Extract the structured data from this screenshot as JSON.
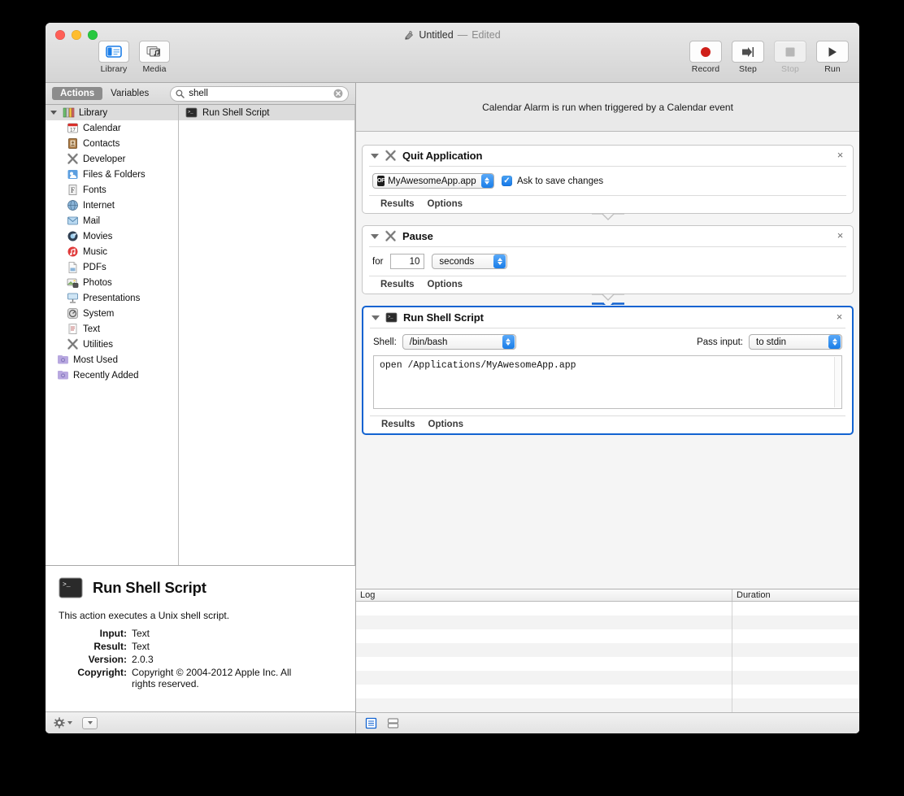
{
  "window": {
    "title": "Untitled",
    "title_separator": "—",
    "edited_status": "Edited",
    "traffic_lights": [
      "close",
      "minimize",
      "zoom"
    ]
  },
  "toolbar": {
    "left_items": [
      {
        "label": "Library",
        "icon": "library-icon",
        "active": true
      },
      {
        "label": "Media",
        "icon": "media-icon",
        "active": false
      }
    ],
    "right_items": [
      {
        "label": "Record",
        "icon": "record-icon",
        "enabled": true
      },
      {
        "label": "Step",
        "icon": "step-icon",
        "enabled": true
      },
      {
        "label": "Stop",
        "icon": "stop-icon",
        "enabled": false
      },
      {
        "label": "Run",
        "icon": "run-icon",
        "enabled": true
      }
    ]
  },
  "library": {
    "tabs": [
      {
        "label": "Actions",
        "active": true
      },
      {
        "label": "Variables",
        "active": false
      }
    ],
    "search": {
      "value": "shell",
      "placeholder": "",
      "icon": "search-icon",
      "clear_icon": "clear-icon"
    },
    "tree_root": {
      "label": "Library",
      "icon": "library-group-icon"
    },
    "tree_items": [
      {
        "label": "Calendar",
        "icon": "calendar-icon"
      },
      {
        "label": "Contacts",
        "icon": "contacts-icon"
      },
      {
        "label": "Developer",
        "icon": "developer-icon"
      },
      {
        "label": "Files & Folders",
        "icon": "files-folders-icon"
      },
      {
        "label": "Fonts",
        "icon": "fonts-icon"
      },
      {
        "label": "Internet",
        "icon": "internet-icon"
      },
      {
        "label": "Mail",
        "icon": "mail-icon"
      },
      {
        "label": "Movies",
        "icon": "movies-icon"
      },
      {
        "label": "Music",
        "icon": "music-icon"
      },
      {
        "label": "PDFs",
        "icon": "pdfs-icon"
      },
      {
        "label": "Photos",
        "icon": "photos-icon"
      },
      {
        "label": "Presentations",
        "icon": "presentations-icon"
      },
      {
        "label": "System",
        "icon": "system-icon"
      },
      {
        "label": "Text",
        "icon": "text-icon"
      },
      {
        "label": "Utilities",
        "icon": "utilities-icon"
      }
    ],
    "smart_groups": [
      {
        "label": "Most Used",
        "icon": "smart-folder-icon"
      },
      {
        "label": "Recently Added",
        "icon": "smart-folder-icon"
      }
    ],
    "action_results": [
      {
        "label": "Run Shell Script",
        "icon": "shell-script-icon",
        "selected": true
      }
    ]
  },
  "info": {
    "title": "Run Shell Script",
    "icon": "shell-script-icon",
    "description": "This action executes a Unix shell script.",
    "fields": [
      {
        "key": "Input:",
        "value": "Text"
      },
      {
        "key": "Result:",
        "value": "Text"
      },
      {
        "key": "Version:",
        "value": "2.0.3"
      },
      {
        "key": "Copyright:",
        "value": "Copyright © 2004-2012 Apple Inc.  All rights reserved."
      }
    ]
  },
  "left_footer": {
    "gear_icon": "gear-icon",
    "gear_chevron_icon": "chevron-down-icon",
    "popup_icon": "popup-button-icon"
  },
  "workflow": {
    "banner": "Calendar Alarm is run when triggered by a Calendar event",
    "actions": [
      {
        "title": "Quit Application",
        "icon": "developer-icon",
        "selected": false,
        "close_label": "×",
        "app_chooser": {
          "value": "MyAwesomeApp.app",
          "icon": "app-icon"
        },
        "checkbox": {
          "label": "Ask to save changes",
          "checked": true
        },
        "footer": [
          "Results",
          "Options"
        ]
      },
      {
        "title": "Pause",
        "icon": "developer-icon",
        "selected": false,
        "close_label": "×",
        "for_label": "for",
        "duration_value": "10",
        "unit_value": "seconds",
        "footer": [
          "Results",
          "Options"
        ]
      },
      {
        "title": "Run Shell Script",
        "icon": "shell-script-icon",
        "selected": true,
        "close_label": "×",
        "shell_label": "Shell:",
        "shell_value": "/bin/bash",
        "pass_input_label": "Pass input:",
        "pass_input_value": "to stdin",
        "script": "open /Applications/MyAwesomeApp.app",
        "footer": [
          "Results",
          "Options"
        ]
      }
    ]
  },
  "log": {
    "columns": [
      "Log",
      "Duration"
    ],
    "rows": [],
    "row_count": 8,
    "footer_buttons": [
      {
        "icon": "log-view-icon",
        "active": true
      },
      {
        "icon": "split-view-icon",
        "active": false
      }
    ]
  }
}
